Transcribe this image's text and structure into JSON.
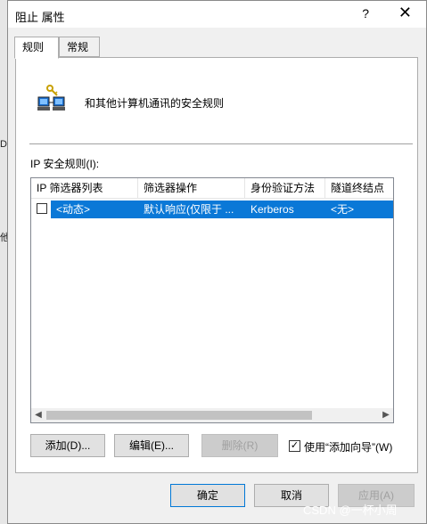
{
  "background_fragments": [
    "D",
    "他"
  ],
  "dialog": {
    "title": "阻止 属性",
    "help": "?",
    "close": "✕"
  },
  "tabs": [
    {
      "label": "规则",
      "active": true
    },
    {
      "label": "常规",
      "active": false
    }
  ],
  "header": {
    "icon": "network-computers-key-icon",
    "description": "和其他计算机通讯的安全规则"
  },
  "rules_label": "IP 安全规则(I):",
  "table": {
    "columns": [
      "IP 筛选器列表",
      "筛选器操作",
      "身份验证方法",
      "隧道终结点"
    ],
    "rows": [
      {
        "checked": false,
        "selected": true,
        "cells": [
          "<动态>",
          "默认响应(仅限于 ...",
          "Kerberos",
          "<无>"
        ]
      }
    ]
  },
  "buttons": {
    "add": "添加(D)...",
    "edit": "编辑(E)...",
    "remove": "删除(R)"
  },
  "wizard": {
    "label": "使用“添加向导”(W)",
    "checked": true,
    "check_glyph": "✓"
  },
  "footer": {
    "ok": "确定",
    "cancel": "取消",
    "apply": "应用(A)"
  },
  "watermark": "CSDN @一杯小周",
  "colors": {
    "selection": "#0a78d7",
    "default_button_border": "#0078d7"
  }
}
